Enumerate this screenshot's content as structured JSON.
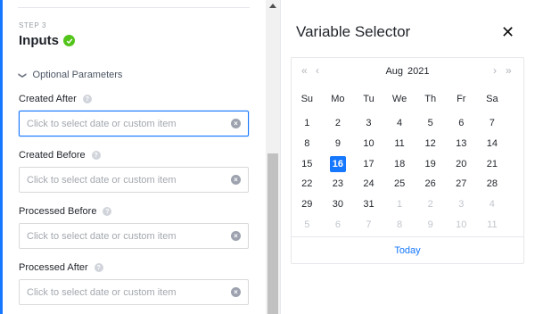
{
  "left": {
    "step_label": "STEP 3",
    "step_title": "Inputs",
    "optional_label": "Optional Parameters",
    "fields": [
      {
        "label": "Created After",
        "placeholder": "Click to select date or custom item"
      },
      {
        "label": "Created Before",
        "placeholder": "Click to select date or custom item"
      },
      {
        "label": "Processed Before",
        "placeholder": "Click to select date or custom item"
      },
      {
        "label": "Processed After",
        "placeholder": "Click to select date or custom item"
      }
    ],
    "help_glyph": "?",
    "clear_glyph": "×"
  },
  "right": {
    "title": "Variable Selector",
    "close_glyph": "✕",
    "calendar": {
      "month": "Aug",
      "year": "2021",
      "nav_prev_year": "«",
      "nav_prev_month": "‹",
      "nav_next_month": "›",
      "nav_next_year": "»",
      "weekdays": [
        "Su",
        "Mo",
        "Tu",
        "We",
        "Th",
        "Fr",
        "Sa"
      ],
      "weeks": [
        [
          "1",
          "2",
          "3",
          "4",
          "5",
          "6",
          "7"
        ],
        [
          "8",
          "9",
          "10",
          "11",
          "12",
          "13",
          "14"
        ],
        [
          "15",
          "16",
          "17",
          "18",
          "19",
          "20",
          "21"
        ],
        [
          "22",
          "23",
          "24",
          "25",
          "26",
          "27",
          "28"
        ],
        [
          "29",
          "30",
          "31",
          "1",
          "2",
          "3",
          "4"
        ],
        [
          "5",
          "6",
          "7",
          "8",
          "9",
          "10",
          "11"
        ]
      ],
      "selected_day": "16",
      "today_label": "Today"
    }
  },
  "colors": {
    "accent": "#1677ff",
    "success": "#52c41a"
  }
}
